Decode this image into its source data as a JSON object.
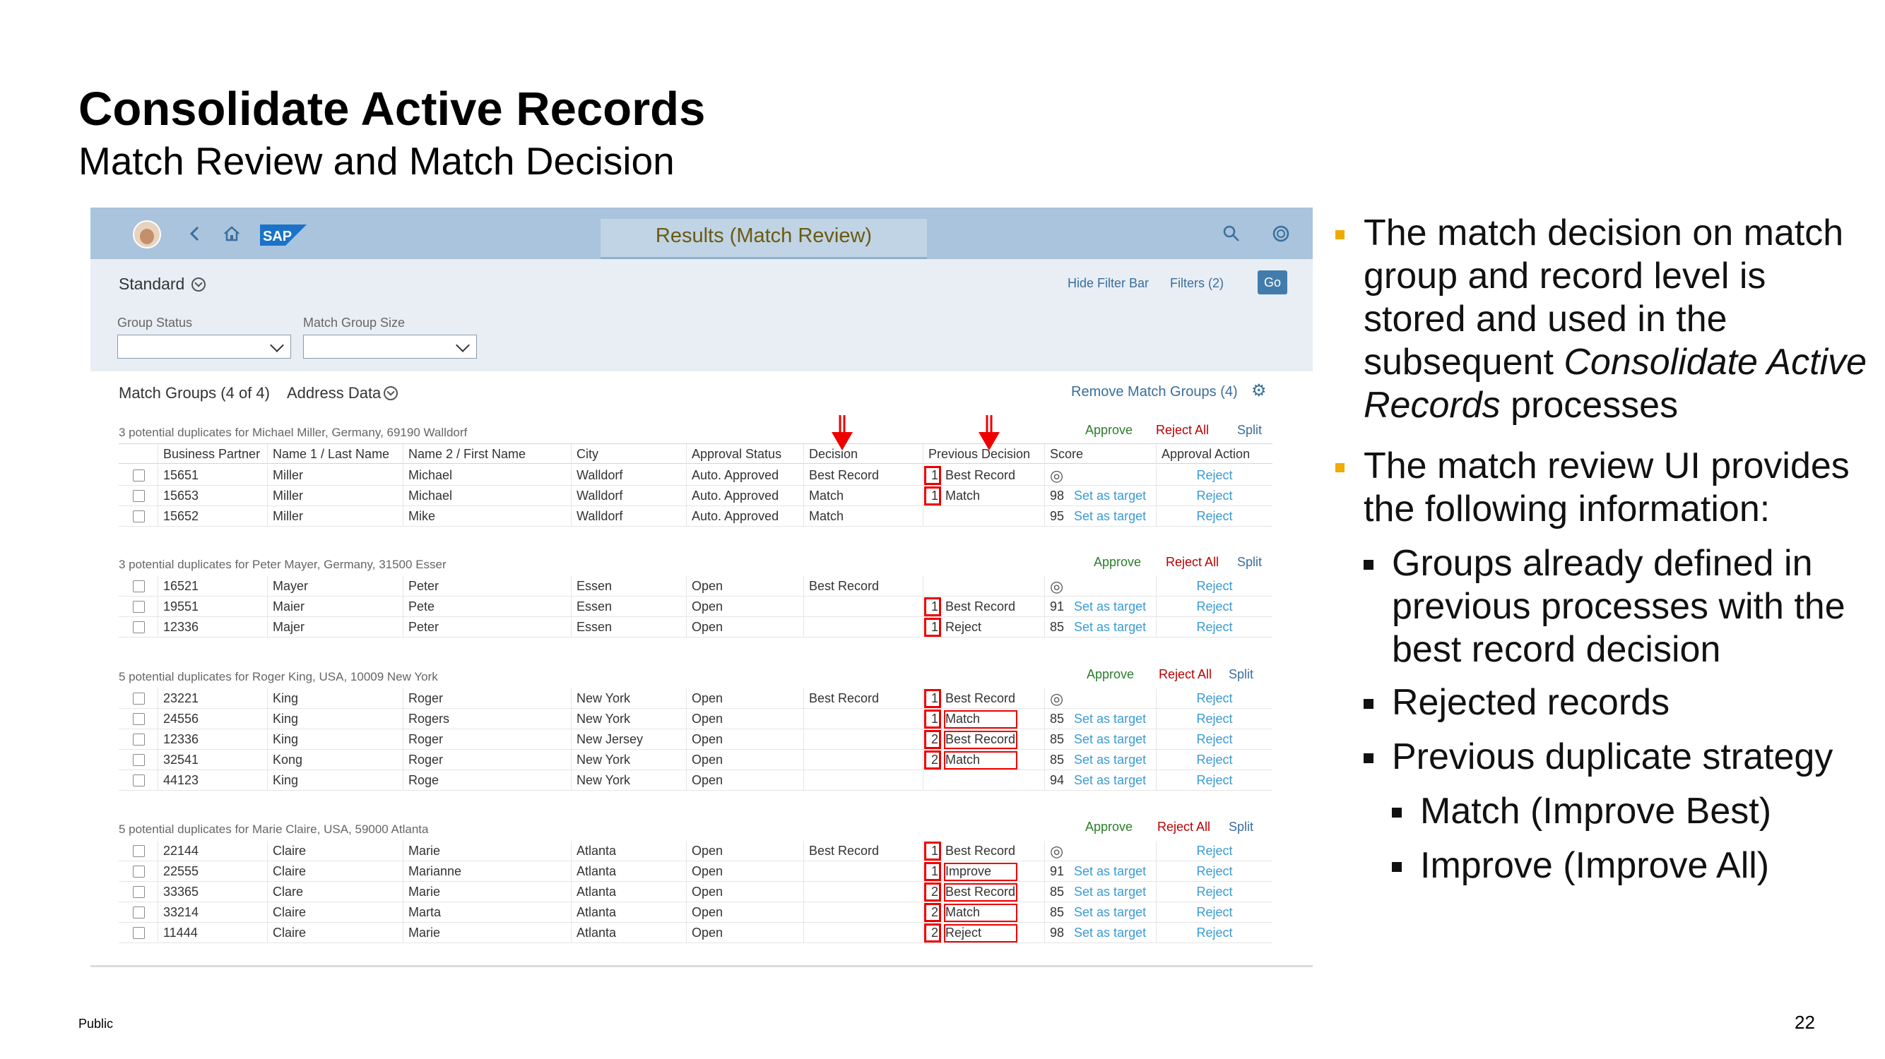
{
  "slide": {
    "title": "Consolidate Active Records",
    "subtitle": "Match Review and Match Decision",
    "footer_label": "Public",
    "page_number": "22"
  },
  "shell": {
    "title": "Results (Match Review)",
    "logo_text": "SAP"
  },
  "filterbar": {
    "variant": "Standard",
    "hide_filter_bar": "Hide Filter Bar",
    "filters": "Filters (2)",
    "go": "Go",
    "group_status_label": "Group Status",
    "match_group_size_label": "Match Group Size"
  },
  "table": {
    "title": "Match Groups (4 of 4)",
    "section": "Address Data",
    "remove_link": "Remove Match Groups (4)",
    "columns": [
      "Business Partner",
      "Name 1 / Last Name",
      "Name 2 / First Name",
      "City",
      "Approval Status",
      "Decision",
      "Previous Decision",
      "Score",
      "Approval Action"
    ],
    "approve": "Approve",
    "reject_all": "Reject All",
    "split": "Split",
    "set_as_target": "Set as target",
    "reject": "Reject",
    "groups": [
      {
        "header": "3 potential duplicates for Michael Miller, Germany, 69190 Walldorf",
        "rows": [
          {
            "bp": "15651",
            "last": "Miller",
            "first": "Michael",
            "city": "Walldorf",
            "status": "Auto. Approved",
            "decision": "Best Record",
            "prev_num": "1",
            "prev": "Best Record",
            "score": "",
            "target": false
          },
          {
            "bp": "15653",
            "last": "Miller",
            "first": "Michael",
            "city": "Walldorf",
            "status": "Auto. Approved",
            "decision": "Match",
            "prev_num": "1",
            "prev": "Match",
            "score": "98",
            "target": true
          },
          {
            "bp": "15652",
            "last": "Miller",
            "first": "Mike",
            "city": "Walldorf",
            "status": "Auto. Approved",
            "decision": "Match",
            "prev_num": "",
            "prev": "",
            "score": "95",
            "target": true
          }
        ]
      },
      {
        "header": "3 potential duplicates for Peter Mayer, Germany, 31500 Esser",
        "rows": [
          {
            "bp": "16521",
            "last": "Mayer",
            "first": "Peter",
            "city": "Essen",
            "status": "Open",
            "decision": "Best Record",
            "prev_num": "",
            "prev": "",
            "score": "",
            "target": false
          },
          {
            "bp": "19551",
            "last": "Maier",
            "first": "Pete",
            "city": "Essen",
            "status": "Open",
            "decision": "",
            "prev_num": "1",
            "prev": "Best Record",
            "score": "91",
            "target": true
          },
          {
            "bp": "12336",
            "last": "Majer",
            "first": "Peter",
            "city": "Essen",
            "status": "Open",
            "decision": "",
            "prev_num": "1",
            "prev": "Reject",
            "score": "85",
            "target": true
          }
        ]
      },
      {
        "header": "5 potential duplicates for Roger King, USA, 10009 New York",
        "rows": [
          {
            "bp": "23221",
            "last": "King",
            "first": "Roger",
            "city": "New York",
            "status": "Open",
            "decision": "Best Record",
            "prev_num": "1",
            "prev": "Best Record",
            "score": "",
            "target": false
          },
          {
            "bp": "24556",
            "last": "King",
            "first": "Rogers",
            "city": "New York",
            "status": "Open",
            "decision": "",
            "prev_num": "1",
            "prev": "Match",
            "score": "85",
            "target": true
          },
          {
            "bp": "12336",
            "last": "King",
            "first": "Roger",
            "city": "New Jersey",
            "status": "Open",
            "decision": "",
            "prev_num": "2",
            "prev": "Best Record",
            "score": "85",
            "target": true
          },
          {
            "bp": "32541",
            "last": "Kong",
            "first": "Roger",
            "city": "New York",
            "status": "Open",
            "decision": "",
            "prev_num": "2",
            "prev": "Match",
            "score": "85",
            "target": true
          },
          {
            "bp": "44123",
            "last": "King",
            "first": "Roge",
            "city": "New York",
            "status": "Open",
            "decision": "",
            "prev_num": "",
            "prev": "",
            "score": "94",
            "target": true
          }
        ]
      },
      {
        "header": "5 potential duplicates for Marie Claire, USA, 59000 Atlanta",
        "rows": [
          {
            "bp": "22144",
            "last": "Claire",
            "first": "Marie",
            "city": "Atlanta",
            "status": "Open",
            "decision": "Best Record",
            "prev_num": "1",
            "prev": "Best Record",
            "score": "",
            "target": false
          },
          {
            "bp": "22555",
            "last": "Claire",
            "first": "Marianne",
            "city": "Atlanta",
            "status": "Open",
            "decision": "",
            "prev_num": "1",
            "prev": "Improve",
            "score": "91",
            "target": true
          },
          {
            "bp": "33365",
            "last": "Clare",
            "first": "Marie",
            "city": "Atlanta",
            "status": "Open",
            "decision": "",
            "prev_num": "2",
            "prev": "Best Record",
            "score": "85",
            "target": true
          },
          {
            "bp": "33214",
            "last": "Claire",
            "first": "Marta",
            "city": "Atlanta",
            "status": "Open",
            "decision": "",
            "prev_num": "2",
            "prev": "Match",
            "score": "85",
            "target": true
          },
          {
            "bp": "11444",
            "last": "Claire",
            "first": "Marie",
            "city": "Atlanta",
            "status": "Open",
            "decision": "",
            "prev_num": "2",
            "prev": "Reject",
            "score": "98",
            "target": true
          }
        ]
      }
    ]
  },
  "bullets": {
    "p1_l1": "The match decision on match",
    "p1_l2": "group and record level is",
    "p1_l3": "stored and used in the",
    "p1_l4a": "subsequent ",
    "p1_l4b": "Consolidate Active",
    "p1_l5a": "Records",
    "p1_l5b": " processes",
    "p2_l1": "The match review UI provides",
    "p2_l2": "the following information:",
    "s1_l1": "Groups already defined in",
    "s1_l2": "previous processes with the",
    "s1_l3": "best record decision",
    "s2": "Rejected records",
    "s3": "Previous duplicate strategy",
    "t1": "Match (Improve Best)",
    "t2": "Improve (Improve All)"
  },
  "colors": {
    "accent_bullet": "#f0ab00",
    "shell_bg": "#a9c4dc",
    "highlight_red": "#e00000",
    "link_blue": "#3a9bd5",
    "approve_green": "#2b7d2b",
    "reject_red": "#bb0000"
  }
}
